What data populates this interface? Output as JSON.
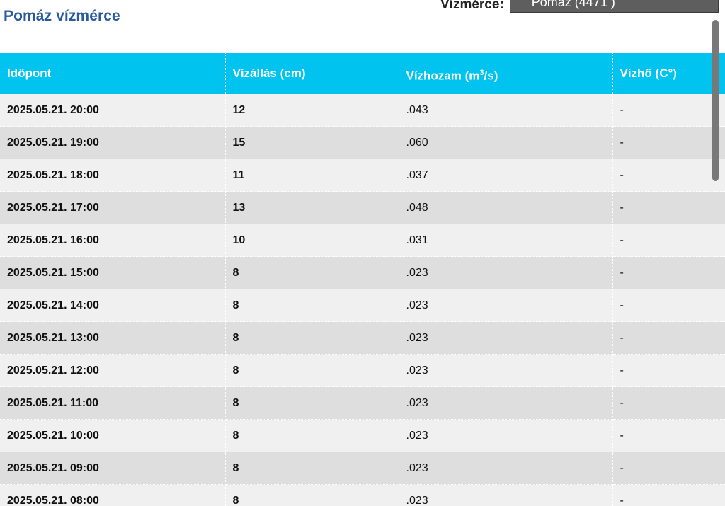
{
  "page": {
    "title": "Pomáz vízmérce"
  },
  "station": {
    "label": "Vízmérce:",
    "selected": "Pomáz (4471 )"
  },
  "table": {
    "headers": {
      "time": "Időpont",
      "level": "Vízállás (cm)",
      "flow_prefix": "Vízhozam (m",
      "flow_sup": "3",
      "flow_suffix": "/s)",
      "temp": "Vízhő (C°)"
    },
    "rows": [
      {
        "time": "2025.05.21. 20:00",
        "level": "12",
        "flow": ".043",
        "temp": "-"
      },
      {
        "time": "2025.05.21. 19:00",
        "level": "15",
        "flow": ".060",
        "temp": "-"
      },
      {
        "time": "2025.05.21. 18:00",
        "level": "11",
        "flow": ".037",
        "temp": "-"
      },
      {
        "time": "2025.05.21. 17:00",
        "level": "13",
        "flow": ".048",
        "temp": "-"
      },
      {
        "time": "2025.05.21. 16:00",
        "level": "10",
        "flow": ".031",
        "temp": "-"
      },
      {
        "time": "2025.05.21. 15:00",
        "level": "8",
        "flow": ".023",
        "temp": "-"
      },
      {
        "time": "2025.05.21. 14:00",
        "level": "8",
        "flow": ".023",
        "temp": "-"
      },
      {
        "time": "2025.05.21. 13:00",
        "level": "8",
        "flow": ".023",
        "temp": "-"
      },
      {
        "time": "2025.05.21. 12:00",
        "level": "8",
        "flow": ".023",
        "temp": "-"
      },
      {
        "time": "2025.05.21. 11:00",
        "level": "8",
        "flow": ".023",
        "temp": "-"
      },
      {
        "time": "2025.05.21. 10:00",
        "level": "8",
        "flow": ".023",
        "temp": "-"
      },
      {
        "time": "2025.05.21. 09:00",
        "level": "8",
        "flow": ".023",
        "temp": "-"
      },
      {
        "time": "2025.05.21. 08:00",
        "level": "8",
        "flow": ".023",
        "temp": "-"
      }
    ]
  },
  "colors": {
    "header_bg": "#00c3ef",
    "title": "#2a5a9e",
    "row_odd": "#f0f0f0",
    "row_even": "#dedede"
  }
}
